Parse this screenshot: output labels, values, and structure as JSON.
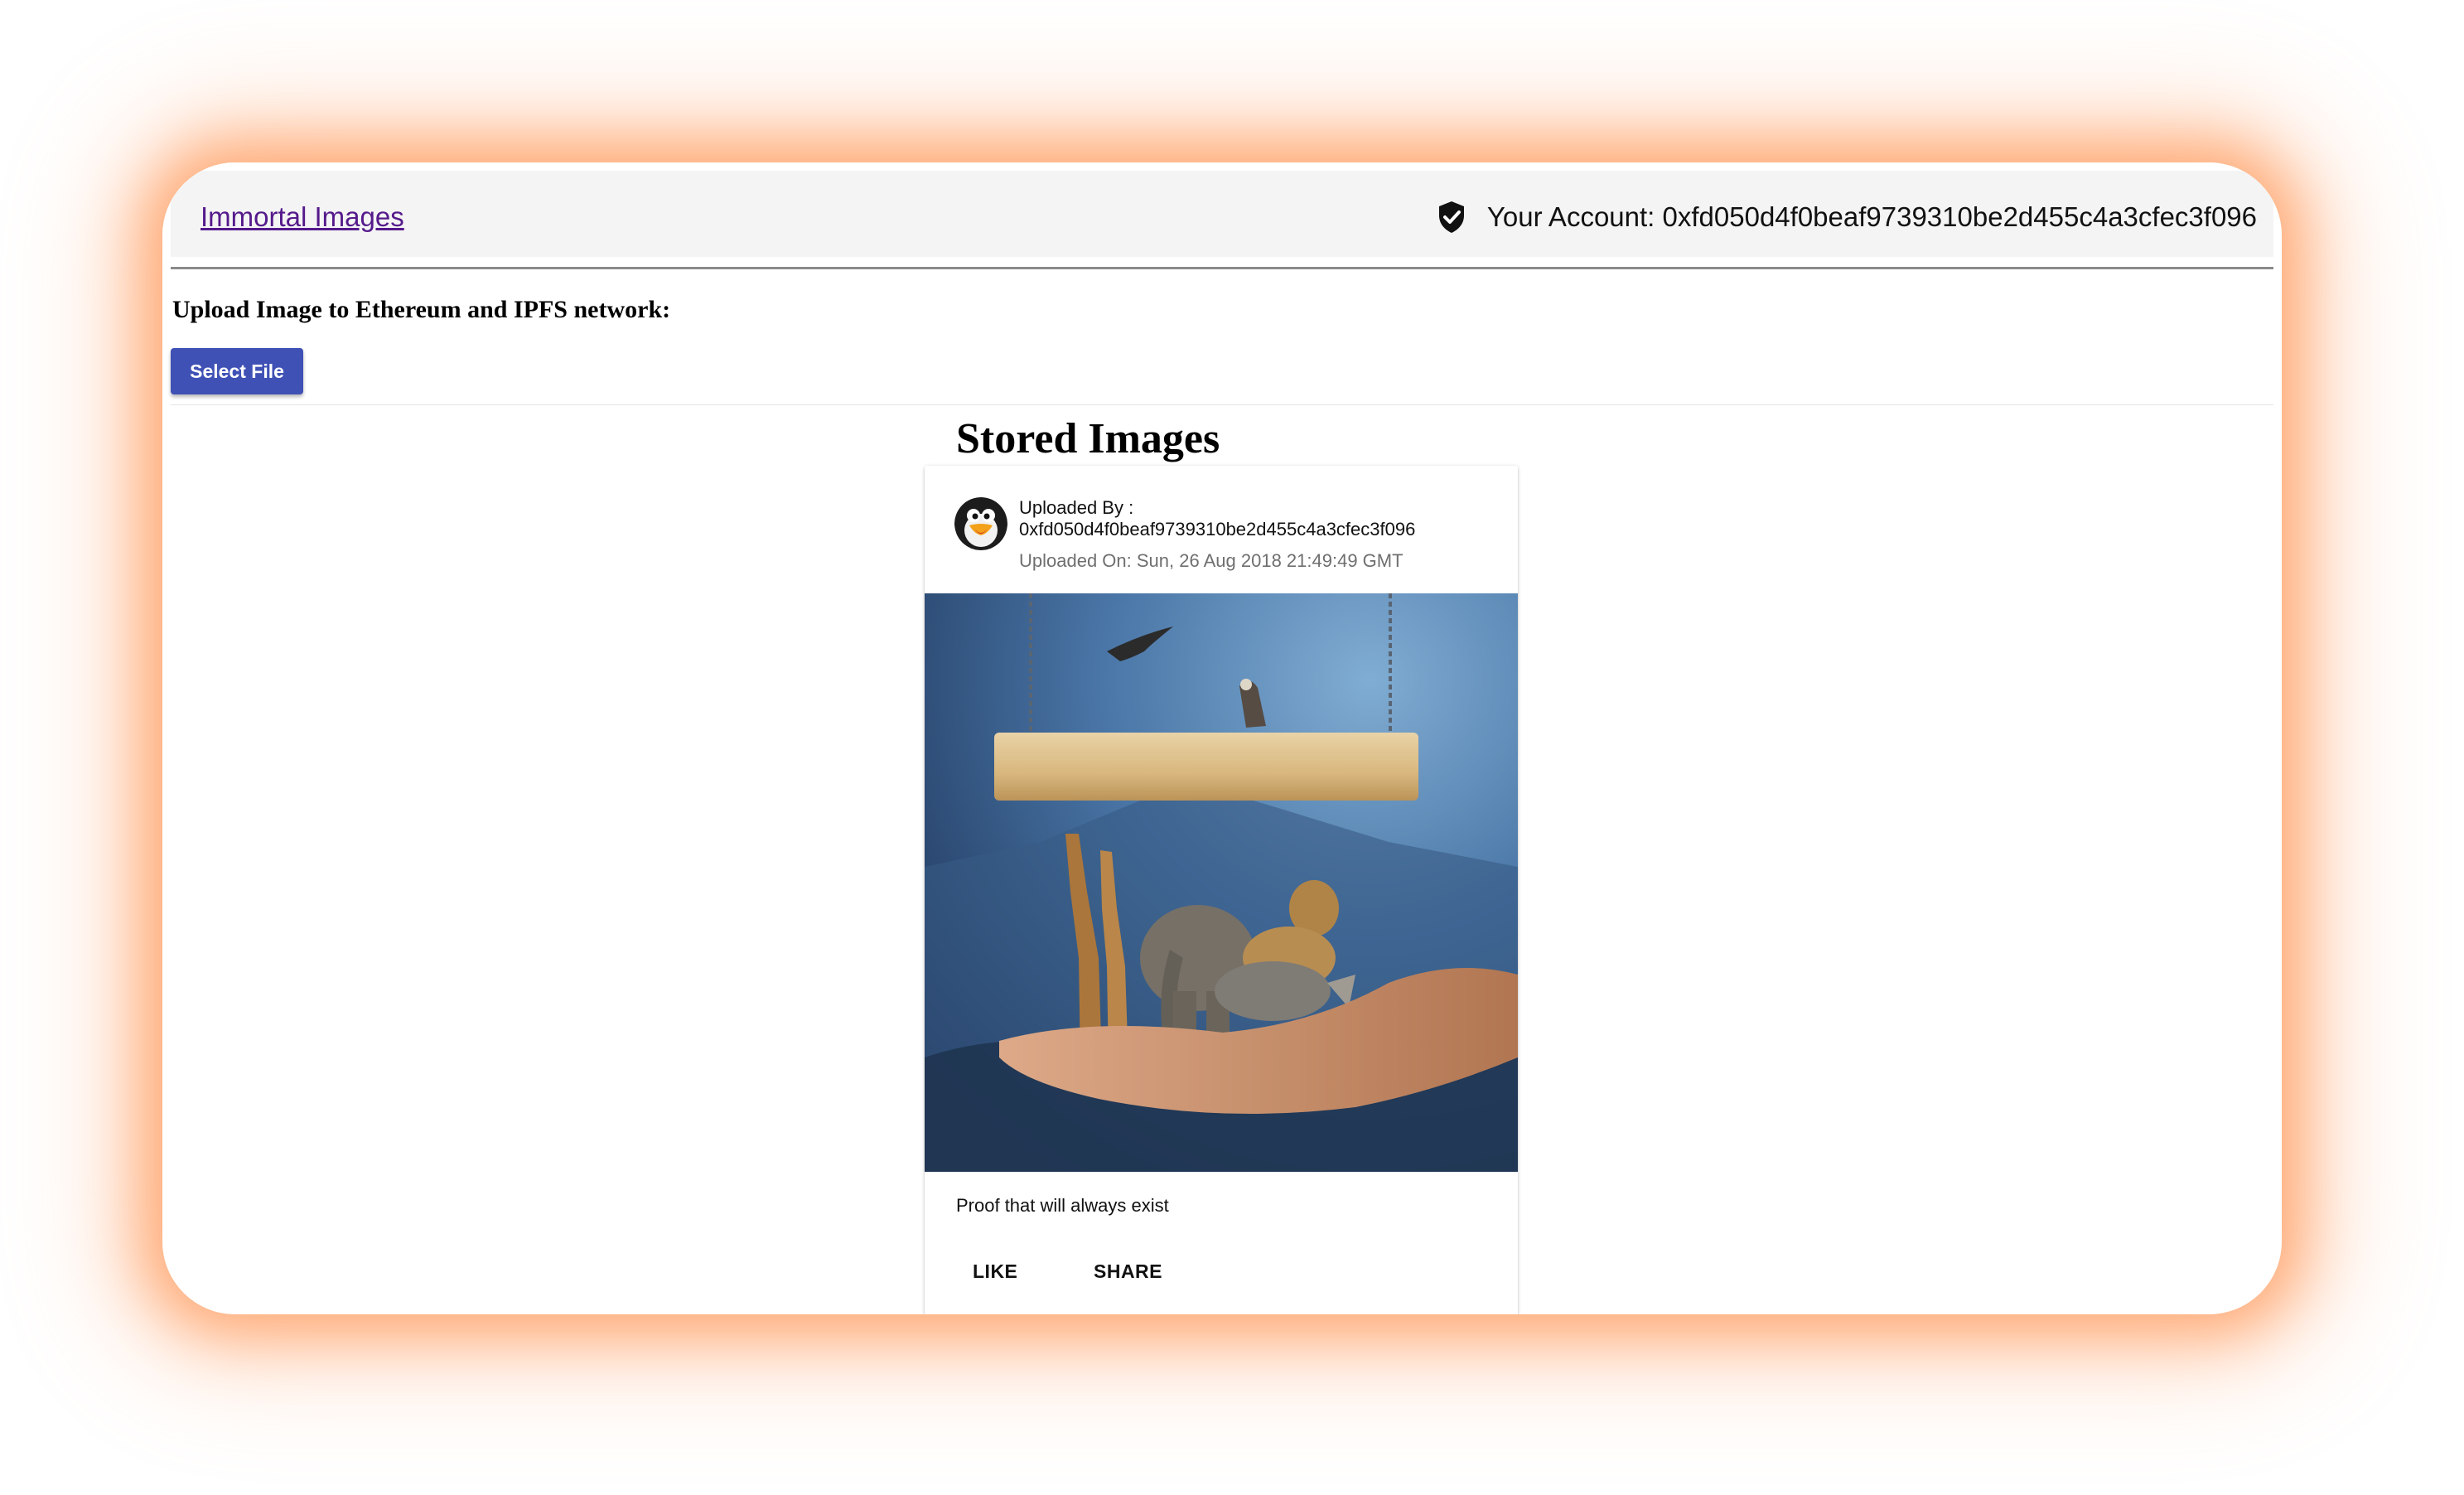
{
  "app": {
    "title": "Immortal Images",
    "account_label": "Your Account: 0xfd050d4f0beaf9739310be2d455c4a3cfec3f096"
  },
  "upload": {
    "heading": "Upload Image to Ethereum and IPFS network:",
    "select_file_label": "Select File"
  },
  "stored": {
    "title": "Stored Images",
    "cards": [
      {
        "uploaded_by_label": "Uploaded By :",
        "uploader_address": "0xfd050d4f0beaf9739310be2d455c4a3cfec3f096",
        "uploaded_on": "Uploaded On: Sun, 26 Aug 2018 21:49:49 GMT",
        "caption": "Proof that will always exist",
        "like_label": "LIKE",
        "share_label": "SHARE"
      }
    ]
  },
  "colors": {
    "primary_button": "#3f51b5",
    "link_visited": "#551a8b",
    "appbar_bg": "#f4f4f4",
    "glow": "#ff7a28"
  },
  "icons": {
    "account": "shield-check-icon",
    "avatar": "penguin-avatar-icon"
  }
}
